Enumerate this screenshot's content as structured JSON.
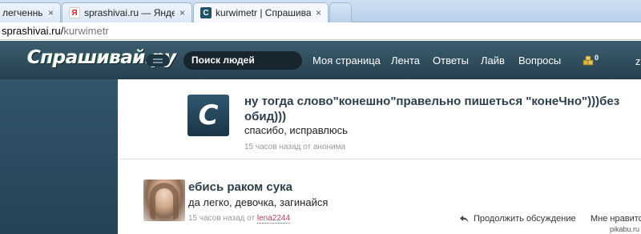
{
  "browser": {
    "tabs": [
      {
        "title": "легченный",
        "favicon": "none",
        "active": false
      },
      {
        "title": "sprashivai.ru — Яндекс: на",
        "favicon": "yandex-icon",
        "favicon_char": "Я",
        "active": false
      },
      {
        "title": "kurwimetr | Спрашивай.ру",
        "favicon": "sprashivai-icon",
        "favicon_char": "C",
        "active": true
      }
    ],
    "close_glyph": "×",
    "address": {
      "host": "sprashivai.ru/",
      "path": "kurwimetr"
    }
  },
  "header": {
    "logo": "Спрашивай.ру",
    "search_placeholder": "Поиск людей",
    "nav": [
      "Моя страница",
      "Лента",
      "Ответы",
      "Лайв",
      "Вопросы"
    ],
    "coin_count": "0",
    "user_initial": "z"
  },
  "feed": {
    "items": [
      {
        "avatar_letter": "C",
        "question": "ну тогда слово\"конешно\"правельно пишеться \"конеЧно\")))без обид)))",
        "answer": "спасибо, исправлюсь",
        "meta": "15 часов назад от анонима"
      },
      {
        "question": "ебись раком сука",
        "answer": "да легко, девочка, загинайся",
        "meta_prefix": "15 часов назад от ",
        "author": "lena2244",
        "continue_label": "Продолжить обсуждение",
        "like_label": "Мне нравитс"
      }
    ]
  },
  "watermark": "pikabu.ru",
  "colors": {
    "header_dark": "#26404e",
    "sidebar": "#2e4f63",
    "title_text": "#2d3e4c",
    "author_link": "#b0425a"
  }
}
